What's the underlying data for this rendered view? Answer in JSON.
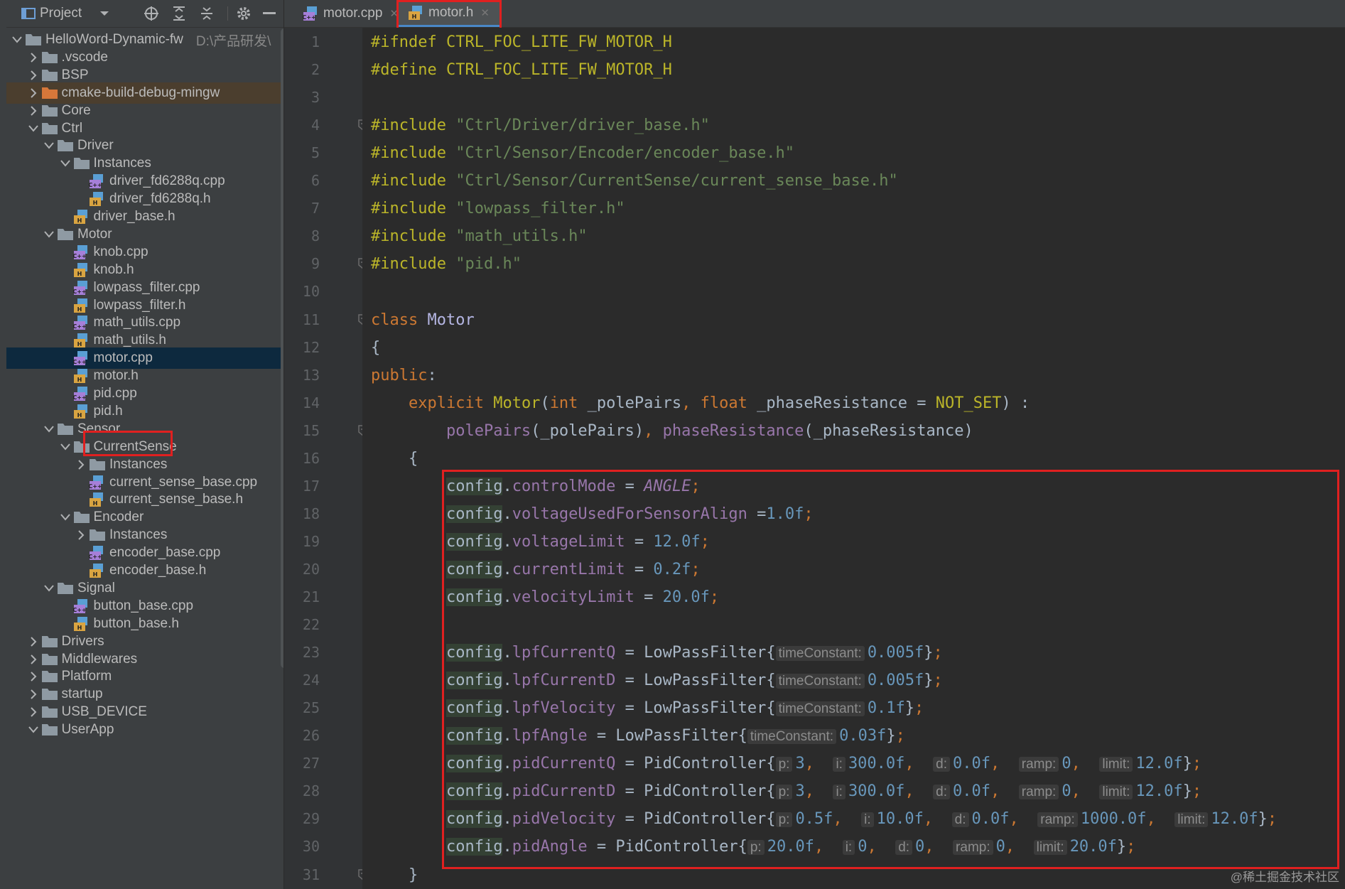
{
  "sidebar": {
    "toolbar": {
      "title": "Project"
    },
    "tree": [
      {
        "label": "HelloWord-Dynamic-fw",
        "hint": "D:\\产品研发\\",
        "type": "folder",
        "expanded": true,
        "depth": 0
      },
      {
        "label": ".vscode",
        "type": "folder",
        "expanded": false,
        "depth": 1
      },
      {
        "label": "BSP",
        "type": "folder",
        "expanded": false,
        "depth": 1
      },
      {
        "label": "cmake-build-debug-mingw",
        "type": "folder-orange",
        "expanded": false,
        "depth": 1,
        "highlight": true
      },
      {
        "label": "Core",
        "type": "folder",
        "expanded": false,
        "depth": 1
      },
      {
        "label": "Ctrl",
        "type": "folder",
        "expanded": true,
        "depth": 1
      },
      {
        "label": "Driver",
        "type": "folder",
        "expanded": true,
        "depth": 2
      },
      {
        "label": "Instances",
        "type": "folder",
        "expanded": true,
        "depth": 3
      },
      {
        "label": "driver_fd6288q.cpp",
        "type": "cpp",
        "depth": 4
      },
      {
        "label": "driver_fd6288q.h",
        "type": "h",
        "depth": 4
      },
      {
        "label": "driver_base.h",
        "type": "h",
        "depth": 3
      },
      {
        "label": "Motor",
        "type": "folder",
        "expanded": true,
        "depth": 2
      },
      {
        "label": "knob.cpp",
        "type": "cpp",
        "depth": 3
      },
      {
        "label": "knob.h",
        "type": "h",
        "depth": 3
      },
      {
        "label": "lowpass_filter.cpp",
        "type": "cpp",
        "depth": 3
      },
      {
        "label": "lowpass_filter.h",
        "type": "h",
        "depth": 3
      },
      {
        "label": "math_utils.cpp",
        "type": "cpp",
        "depth": 3
      },
      {
        "label": "math_utils.h",
        "type": "h",
        "depth": 3
      },
      {
        "label": "motor.cpp",
        "type": "cpp",
        "depth": 3,
        "selected": true
      },
      {
        "label": "motor.h",
        "type": "h",
        "depth": 3,
        "boxed": true
      },
      {
        "label": "pid.cpp",
        "type": "cpp",
        "depth": 3
      },
      {
        "label": "pid.h",
        "type": "h",
        "depth": 3
      },
      {
        "label": "Sensor",
        "type": "folder",
        "expanded": true,
        "depth": 2
      },
      {
        "label": "CurrentSense",
        "type": "folder",
        "expanded": true,
        "depth": 3
      },
      {
        "label": "Instances",
        "type": "folder",
        "expanded": false,
        "depth": 4
      },
      {
        "label": "current_sense_base.cpp",
        "type": "cpp",
        "depth": 4
      },
      {
        "label": "current_sense_base.h",
        "type": "h",
        "depth": 4
      },
      {
        "label": "Encoder",
        "type": "folder",
        "expanded": true,
        "depth": 3
      },
      {
        "label": "Instances",
        "type": "folder",
        "expanded": false,
        "depth": 4
      },
      {
        "label": "encoder_base.cpp",
        "type": "cpp",
        "depth": 4
      },
      {
        "label": "encoder_base.h",
        "type": "h",
        "depth": 4
      },
      {
        "label": "Signal",
        "type": "folder",
        "expanded": true,
        "depth": 2
      },
      {
        "label": "button_base.cpp",
        "type": "cpp",
        "depth": 3
      },
      {
        "label": "button_base.h",
        "type": "h",
        "depth": 3
      },
      {
        "label": "Drivers",
        "type": "folder",
        "expanded": false,
        "depth": 1
      },
      {
        "label": "Middlewares",
        "type": "folder",
        "expanded": false,
        "depth": 1
      },
      {
        "label": "Platform",
        "type": "folder",
        "expanded": false,
        "depth": 1
      },
      {
        "label": "startup",
        "type": "folder",
        "expanded": false,
        "depth": 1
      },
      {
        "label": "USB_DEVICE",
        "type": "folder",
        "expanded": false,
        "depth": 1
      },
      {
        "label": "UserApp",
        "type": "folder",
        "expanded": true,
        "depth": 1
      }
    ]
  },
  "tabs": [
    {
      "label": "motor.cpp",
      "type": "cpp",
      "active": false
    },
    {
      "label": "motor.h",
      "type": "h",
      "active": true
    }
  ],
  "code": [
    [
      [
        "pp",
        "#ifndef "
      ],
      [
        "mac",
        "CTRL_FOC_LITE_FW_MOTOR_H"
      ]
    ],
    [
      [
        "pp",
        "#define "
      ],
      [
        "mac",
        "CTRL_FOC_LITE_FW_MOTOR_H"
      ]
    ],
    [],
    [
      [
        "pp",
        "#include "
      ],
      [
        "str",
        "\"Ctrl/Driver/driver_base.h\""
      ]
    ],
    [
      [
        "pp",
        "#include "
      ],
      [
        "str",
        "\"Ctrl/Sensor/Encoder/encoder_base.h\""
      ]
    ],
    [
      [
        "pp",
        "#include "
      ],
      [
        "str",
        "\"Ctrl/Sensor/CurrentSense/current_sense_base.h\""
      ]
    ],
    [
      [
        "pp",
        "#include "
      ],
      [
        "str",
        "\"lowpass_filter.h\""
      ]
    ],
    [
      [
        "pp",
        "#include "
      ],
      [
        "str",
        "\"math_utils.h\""
      ]
    ],
    [
      [
        "pp",
        "#include "
      ],
      [
        "str",
        "\"pid.h\""
      ]
    ],
    [],
    [
      [
        "kw",
        "class "
      ],
      [
        "cls",
        "Motor"
      ]
    ],
    [
      [
        "t",
        "{"
      ]
    ],
    [
      [
        "kw",
        "public"
      ],
      [
        "t",
        ":"
      ]
    ],
    [
      [
        "t",
        "    "
      ],
      [
        "kw",
        "explicit "
      ],
      [
        "pp",
        "Motor"
      ],
      [
        "t",
        "("
      ],
      [
        "kw",
        "int "
      ],
      [
        "t",
        "_polePairs"
      ],
      [
        "kw",
        ", "
      ],
      [
        "kw",
        "float "
      ],
      [
        "t",
        "_phaseResistance = "
      ],
      [
        "mac",
        "NOT_SET"
      ],
      [
        "t",
        ") :"
      ]
    ],
    [
      [
        "t",
        "        "
      ],
      [
        "fld",
        "polePairs"
      ],
      [
        "t",
        "(_polePairs)"
      ],
      [
        "kw",
        ", "
      ],
      [
        "fld",
        "phaseResistance"
      ],
      [
        "t",
        "(_phaseResistance)"
      ]
    ],
    [
      [
        "t",
        "    {"
      ]
    ],
    [
      [
        "t",
        "        "
      ],
      [
        "var",
        "config"
      ],
      [
        "t",
        "."
      ],
      [
        "fld",
        "controlMode"
      ],
      [
        "t",
        " = "
      ],
      [
        "italic",
        "ANGLE"
      ],
      [
        "kw",
        ";"
      ]
    ],
    [
      [
        "t",
        "        "
      ],
      [
        "var",
        "config"
      ],
      [
        "t",
        "."
      ],
      [
        "fld",
        "voltageUsedForSensorAlign"
      ],
      [
        "t",
        " ="
      ],
      [
        "num",
        "1.0f"
      ],
      [
        "kw",
        ";"
      ]
    ],
    [
      [
        "t",
        "        "
      ],
      [
        "var",
        "config"
      ],
      [
        "t",
        "."
      ],
      [
        "fld",
        "voltageLimit"
      ],
      [
        "t",
        " = "
      ],
      [
        "num",
        "12.0f"
      ],
      [
        "kw",
        ";"
      ]
    ],
    [
      [
        "t",
        "        "
      ],
      [
        "var",
        "config"
      ],
      [
        "t",
        "."
      ],
      [
        "fld",
        "currentLimit"
      ],
      [
        "t",
        " = "
      ],
      [
        "num",
        "0.2f"
      ],
      [
        "kw",
        ";"
      ]
    ],
    [
      [
        "t",
        "        "
      ],
      [
        "var",
        "config"
      ],
      [
        "t",
        "."
      ],
      [
        "fld",
        "velocityLimit"
      ],
      [
        "t",
        " = "
      ],
      [
        "num",
        "20.0f"
      ],
      [
        "kw",
        ";"
      ]
    ],
    [],
    [
      [
        "t",
        "        "
      ],
      [
        "var",
        "config"
      ],
      [
        "t",
        "."
      ],
      [
        "fld",
        "lpfCurrentQ"
      ],
      [
        "t",
        " = LowPassFilter{"
      ],
      [
        "hint",
        "timeConstant:"
      ],
      [
        "num",
        "0.005f"
      ],
      [
        "t",
        "}"
      ],
      [
        "kw",
        ";"
      ]
    ],
    [
      [
        "t",
        "        "
      ],
      [
        "var",
        "config"
      ],
      [
        "t",
        "."
      ],
      [
        "fld",
        "lpfCurrentD"
      ],
      [
        "t",
        " = LowPassFilter{"
      ],
      [
        "hint",
        "timeConstant:"
      ],
      [
        "num",
        "0.005f"
      ],
      [
        "t",
        "}"
      ],
      [
        "kw",
        ";"
      ]
    ],
    [
      [
        "t",
        "        "
      ],
      [
        "var",
        "config"
      ],
      [
        "t",
        "."
      ],
      [
        "fld",
        "lpfVelocity"
      ],
      [
        "t",
        " = LowPassFilter{"
      ],
      [
        "hint",
        "timeConstant:"
      ],
      [
        "num",
        "0.1f"
      ],
      [
        "t",
        "}"
      ],
      [
        "kw",
        ";"
      ]
    ],
    [
      [
        "t",
        "        "
      ],
      [
        "var",
        "config"
      ],
      [
        "t",
        "."
      ],
      [
        "fld",
        "lpfAngle"
      ],
      [
        "t",
        " = LowPassFilter{"
      ],
      [
        "hint",
        "timeConstant:"
      ],
      [
        "num",
        "0.03f"
      ],
      [
        "t",
        "}"
      ],
      [
        "kw",
        ";"
      ]
    ],
    [
      [
        "t",
        "        "
      ],
      [
        "var",
        "config"
      ],
      [
        "t",
        "."
      ],
      [
        "fld",
        "pidCurrentQ"
      ],
      [
        "t",
        " = PidController{"
      ],
      [
        "hint",
        "p:"
      ],
      [
        "num",
        "3"
      ],
      [
        "kw",
        ",  "
      ],
      [
        "hint",
        "i:"
      ],
      [
        "num",
        "300.0f"
      ],
      [
        "kw",
        ",  "
      ],
      [
        "hint",
        "d:"
      ],
      [
        "num",
        "0.0f"
      ],
      [
        "kw",
        ",  "
      ],
      [
        "hint",
        "ramp:"
      ],
      [
        "num",
        "0"
      ],
      [
        "kw",
        ",  "
      ],
      [
        "hint",
        "limit:"
      ],
      [
        "num",
        "12.0f"
      ],
      [
        "t",
        "}"
      ],
      [
        "kw",
        ";"
      ]
    ],
    [
      [
        "t",
        "        "
      ],
      [
        "var",
        "config"
      ],
      [
        "t",
        "."
      ],
      [
        "fld",
        "pidCurrentD"
      ],
      [
        "t",
        " = PidController{"
      ],
      [
        "hint",
        "p:"
      ],
      [
        "num",
        "3"
      ],
      [
        "kw",
        ",  "
      ],
      [
        "hint",
        "i:"
      ],
      [
        "num",
        "300.0f"
      ],
      [
        "kw",
        ",  "
      ],
      [
        "hint",
        "d:"
      ],
      [
        "num",
        "0.0f"
      ],
      [
        "kw",
        ",  "
      ],
      [
        "hint",
        "ramp:"
      ],
      [
        "num",
        "0"
      ],
      [
        "kw",
        ",  "
      ],
      [
        "hint",
        "limit:"
      ],
      [
        "num",
        "12.0f"
      ],
      [
        "t",
        "}"
      ],
      [
        "kw",
        ";"
      ]
    ],
    [
      [
        "t",
        "        "
      ],
      [
        "var",
        "config"
      ],
      [
        "t",
        "."
      ],
      [
        "fld",
        "pidVelocity"
      ],
      [
        "t",
        " = PidController{"
      ],
      [
        "hint",
        "p:"
      ],
      [
        "num",
        "0.5f"
      ],
      [
        "kw",
        ",  "
      ],
      [
        "hint",
        "i:"
      ],
      [
        "num",
        "10.0f"
      ],
      [
        "kw",
        ",  "
      ],
      [
        "hint",
        "d:"
      ],
      [
        "num",
        "0.0f"
      ],
      [
        "kw",
        ",  "
      ],
      [
        "hint",
        "ramp:"
      ],
      [
        "num",
        "1000.0f"
      ],
      [
        "kw",
        ",  "
      ],
      [
        "hint",
        "limit:"
      ],
      [
        "num",
        "12.0f"
      ],
      [
        "t",
        "}"
      ],
      [
        "kw",
        ";"
      ]
    ],
    [
      [
        "t",
        "        "
      ],
      [
        "var",
        "config"
      ],
      [
        "t",
        "."
      ],
      [
        "fld",
        "pidAngle"
      ],
      [
        "t",
        " = PidController{"
      ],
      [
        "hint",
        "p:"
      ],
      [
        "num",
        "20.0f"
      ],
      [
        "kw",
        ",  "
      ],
      [
        "hint",
        "i:"
      ],
      [
        "num",
        "0"
      ],
      [
        "kw",
        ",  "
      ],
      [
        "hint",
        "d:"
      ],
      [
        "num",
        "0"
      ],
      [
        "kw",
        ",  "
      ],
      [
        "hint",
        "ramp:"
      ],
      [
        "num",
        "0"
      ],
      [
        "kw",
        ",  "
      ],
      [
        "hint",
        "limit:"
      ],
      [
        "num",
        "20.0f"
      ],
      [
        "t",
        "}"
      ],
      [
        "kw",
        ";"
      ]
    ],
    [
      [
        "t",
        "    }"
      ]
    ]
  ],
  "colors": {
    "accent": "#4a88c7",
    "highlight_box": "#e02020",
    "selection": "#0d293e"
  },
  "watermark": "@稀土掘金技术社区"
}
